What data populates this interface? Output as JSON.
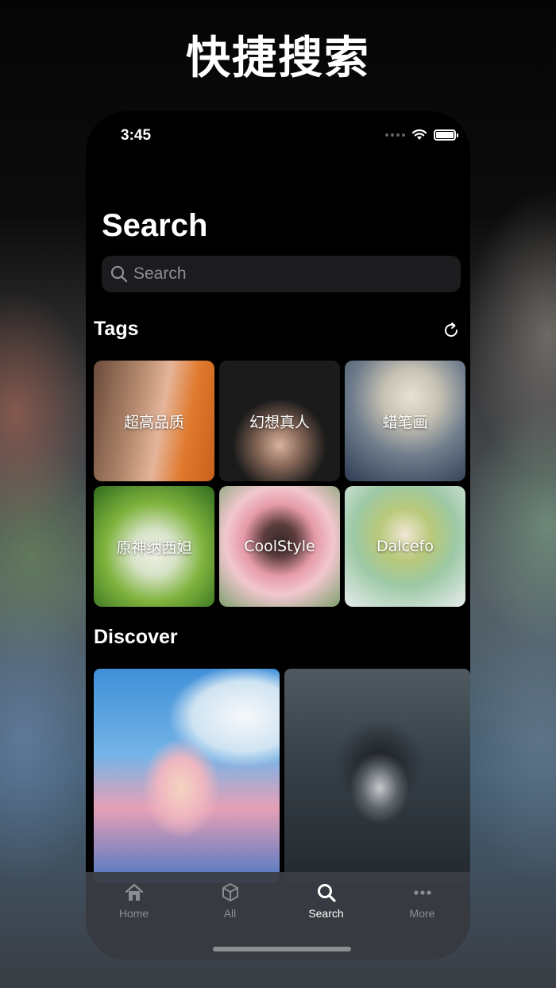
{
  "hero": {
    "title": "快捷搜索"
  },
  "status": {
    "time": "3:45"
  },
  "page": {
    "title": "Search"
  },
  "search": {
    "placeholder": "Search"
  },
  "tags": {
    "title": "Tags",
    "refresh_icon": "refresh-icon",
    "items": [
      {
        "label": "超高品质"
      },
      {
        "label": "幻想真人"
      },
      {
        "label": "蜡笔画"
      },
      {
        "label": "原神纳西妲"
      },
      {
        "label": "CoolStyle"
      },
      {
        "label": "Dalcefo"
      }
    ]
  },
  "discover": {
    "title": "Discover"
  },
  "tabbar": {
    "items": [
      {
        "label": "Home",
        "icon": "home-icon"
      },
      {
        "label": "All",
        "icon": "cubes-icon"
      },
      {
        "label": "Search",
        "icon": "search-icon"
      },
      {
        "label": "More",
        "icon": "more-icon"
      }
    ],
    "active": "Search"
  }
}
